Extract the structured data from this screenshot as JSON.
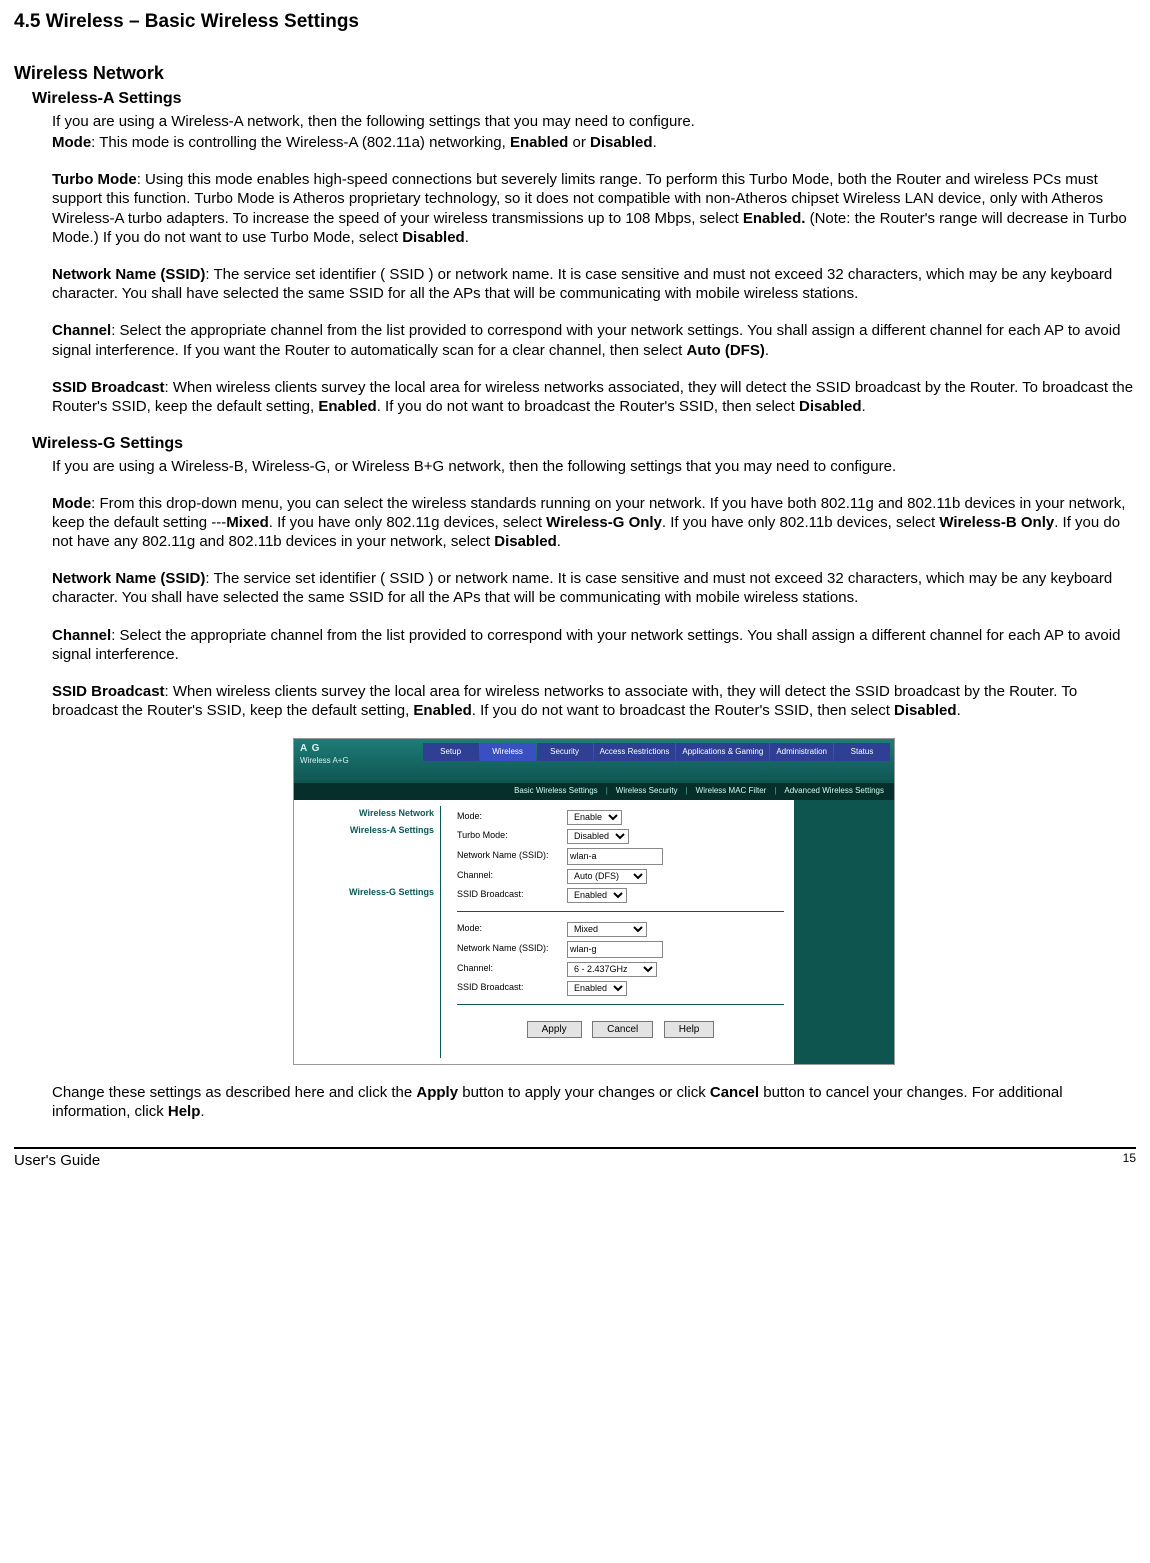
{
  "title": "4.5 Wireless – Basic Wireless Settings",
  "h_network": "Wireless Network",
  "h_a": "Wireless-A Settings",
  "a_intro": "If you are using a Wireless-A network, then the following settings that you may need to configure.",
  "a_mode_pre": "Mode",
  "a_mode_txt": ": This mode is controlling the Wireless-A (802.11a) networking, ",
  "a_mode_b1": "Enabled",
  "a_mode_mid": " or ",
  "a_mode_b2": "Disabled",
  "a_mode_end": ".",
  "a_turbo_pre": "Turbo Mode",
  "a_turbo_txt1": ": Using this mode enables high-speed connections but severely limits range. To perform this Turbo Mode, both the Router and wireless PCs must support this function. Turbo Mode is Atheros proprietary technology, so it does not compatible with non-Atheros chipset Wireless LAN device, only with Atheros Wireless-A turbo adapters. To increase the speed of your wireless transmissions up to 108 Mbps, select ",
  "a_turbo_b1": "Enabled.",
  "a_turbo_txt2": " (Note: the Router's range will decrease in Turbo Mode.) If you do not want to use Turbo Mode, select ",
  "a_turbo_b2": "Disabled",
  "a_turbo_end": ".",
  "a_ssid_pre": "Network Name (SSID)",
  "a_ssid_txt": ": The service set identifier ( SSID ) or network name. It is case sensitive and must not exceed 32 characters, which may be any keyboard character. You shall have selected the same SSID for all the APs that will be communicating with mobile wireless stations.",
  "a_ch_pre": "Channel",
  "a_ch_txt1": ": Select the appropriate channel from the list provided to correspond with your network settings. You shall assign a different channel for each AP to avoid signal interference. If you want the Router to automatically scan for a clear channel, then select ",
  "a_ch_b1": "Auto (DFS)",
  "a_ch_end": ".",
  "a_bc_pre": "SSID Broadcast",
  "a_bc_txt1": ": When wireless clients survey the local area for wireless networks associated, they will detect the SSID broadcast by the Router. To broadcast the Router's SSID, keep the default setting, ",
  "a_bc_b1": "Enabled",
  "a_bc_txt2": ". If you do not want to broadcast the Router's SSID, then select ",
  "a_bc_b2": "Disabled",
  "a_bc_end": ".",
  "h_g": "Wireless-G Settings",
  "g_intro": "If you are using a Wireless-B, Wireless-G, or Wireless B+G network, then the following settings that you may need to configure.",
  "g_mode_pre": "Mode",
  "g_mode_txt1": ": From this drop-down menu, you can select the wireless standards running on your network. If you have both 802.11g and 802.11b devices in your network, keep the default setting ---",
  "g_mode_b1": "Mixed",
  "g_mode_txt2": ". If you have only 802.11g devices, select ",
  "g_mode_b2": "Wireless-G Only",
  "g_mode_txt3": ". If you have only 802.11b devices, select ",
  "g_mode_b3": "Wireless-B Only",
  "g_mode_txt4": ". If you do not have any 802.11g and 802.11b devices in your network, select ",
  "g_mode_b4": "Disabled",
  "g_mode_end": ".",
  "g_ssid_pre": "Network Name (SSID)",
  "g_ssid_txt": ": The service set identifier ( SSID ) or network name. It is case sensitive and must not exceed 32 characters, which may be any keyboard character. You shall have selected the same SSID for all the APs that will be communicating with mobile wireless stations.",
  "g_ch_pre": "Channel",
  "g_ch_txt": ": Select the appropriate channel from the list provided to correspond with your network settings. You shall assign a different channel for each AP to avoid signal interference.",
  "g_bc_pre": "SSID Broadcast",
  "g_bc_txt1": ": When wireless clients survey the local area for wireless networks to associate with, they will detect the SSID broadcast by the Router. To broadcast the Router's SSID, keep the default setting, ",
  "g_bc_b1": "Enabled",
  "g_bc_txt2": ". If you do not want to broadcast the Router's SSID, then select ",
  "g_bc_b2": "Disabled",
  "g_bc_end": ".",
  "closing_txt1": "Change these settings as described here and click the ",
  "closing_b1": "Apply",
  "closing_txt2": " button to apply your changes or click ",
  "closing_b2": "Cancel",
  "closing_txt3": " button to cancel your changes. For additional information, click ",
  "closing_b3": "Help",
  "closing_end": ".",
  "footer_left": "User's Guide",
  "footer_right": "15",
  "ss": {
    "logo_top": "A G",
    "logo_bottom": "Wireless A+G",
    "tabs": [
      "Setup",
      "Wireless",
      "Security",
      "Access Restrictions",
      "Applications & Gaming",
      "Administration",
      "Status"
    ],
    "subtabs": [
      "Basic Wireless Settings",
      "Wireless Security",
      "Wireless MAC Filter",
      "Advanced Wireless Settings"
    ],
    "side_title": "Wireless Network",
    "side_a": "Wireless-A Settings",
    "side_g": "Wireless-G Settings",
    "labels": {
      "mode": "Mode:",
      "turbo": "Turbo Mode:",
      "ssid": "Network Name (SSID):",
      "channel": "Channel:",
      "broadcast": "SSID Broadcast:"
    },
    "a": {
      "mode": "Enable",
      "turbo": "Disabled",
      "ssid": "wlan-a",
      "channel": "Auto (DFS)",
      "broadcast": "Enabled"
    },
    "g": {
      "mode": "Mixed",
      "ssid": "wlan-g",
      "channel": "6 - 2.437GHz",
      "broadcast": "Enabled"
    },
    "buttons": {
      "apply": "Apply",
      "cancel": "Cancel",
      "help": "Help"
    }
  }
}
